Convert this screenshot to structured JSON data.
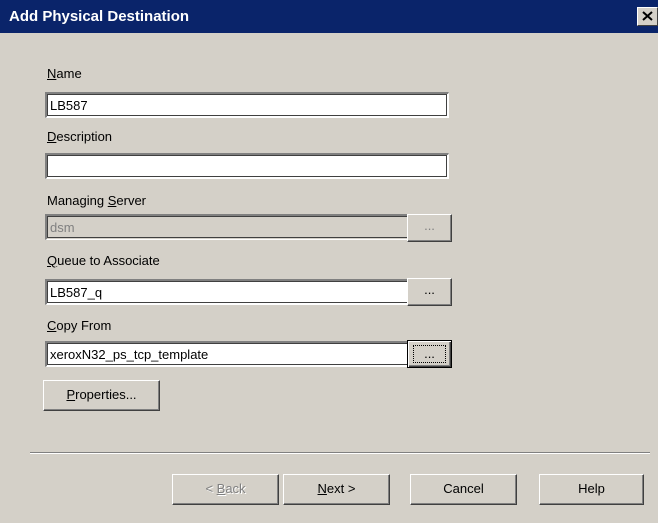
{
  "window": {
    "title": "Add Physical Destination"
  },
  "form": {
    "name_label_key": "N",
    "name_label_rest": "ame",
    "name_value": "LB587",
    "description_label_key": "D",
    "description_label_rest": "escription",
    "description_value": "",
    "managing_label_pre": "Managing ",
    "managing_label_key": "S",
    "managing_label_rest": "erver",
    "managing_value": "dsm",
    "queue_label_key": "Q",
    "queue_label_rest": "ueue to Associate",
    "queue_value": "LB587_q",
    "copy_label_key": "C",
    "copy_label_rest": "opy From",
    "copy_value": "xeroxN32_ps_tcp_template",
    "browse_label": "...",
    "properties_key": "P",
    "properties_rest": "roperties..."
  },
  "buttons": {
    "back_pre": "< ",
    "back_key": "B",
    "back_rest": "ack",
    "next_key": "N",
    "next_rest": "ext >",
    "cancel": "Cancel",
    "help": "Help"
  },
  "icons": {
    "close": "close-icon"
  }
}
